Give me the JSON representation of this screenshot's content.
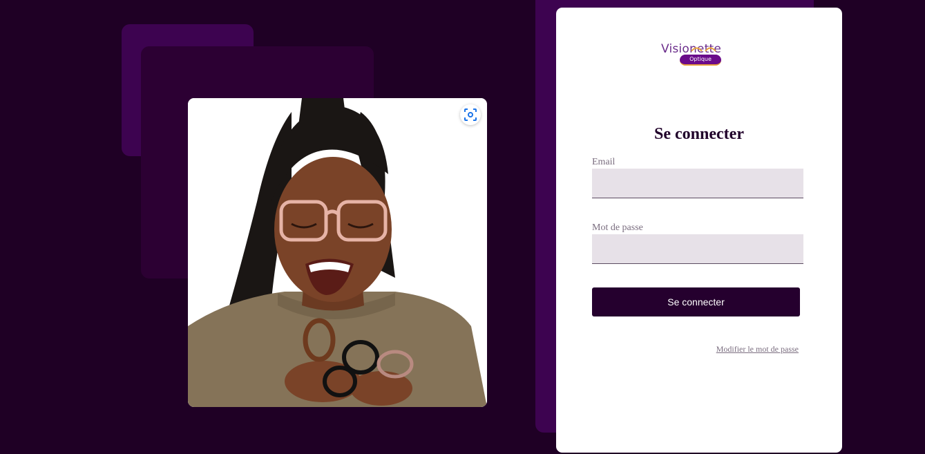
{
  "brand": {
    "logo_word": "Visionette",
    "logo_sub": "Optique"
  },
  "photo": {
    "lens_icon": "visual-search-icon"
  },
  "login": {
    "title": "Se connecter",
    "email_label": "Email",
    "email_value": "",
    "password_label": "Mot de passe",
    "password_value": "",
    "submit_label": "Se connecter",
    "forgot_link": "Modifier le mot de passe"
  },
  "colors": {
    "background": "#1f0025",
    "accent": "#3d0350",
    "button": "#25002e",
    "input_bg": "#e7e1e8",
    "logo_purple": "#6a0a8a",
    "logo_gold": "#e7a23b"
  }
}
